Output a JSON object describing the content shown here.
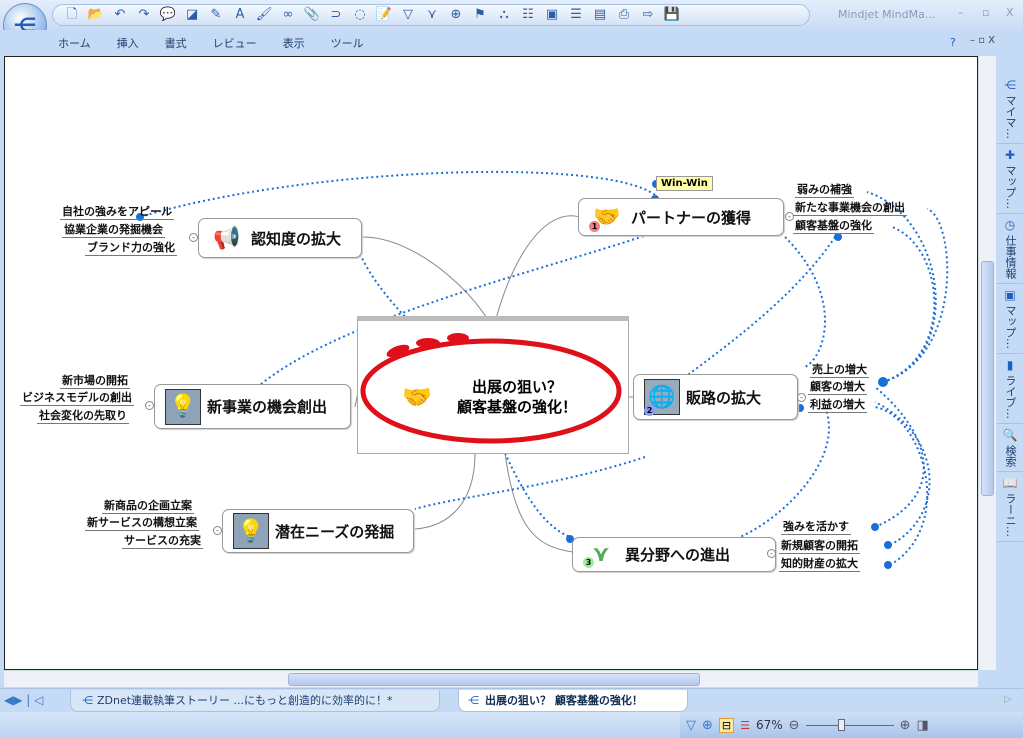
{
  "window": {
    "title": "Mindjet MindMa...",
    "app_button_icon": "mindmap-logo-icon"
  },
  "quick_access": [
    "new-icon",
    "open-icon",
    "undo-icon",
    "redo-icon",
    "callout-icon",
    "fill-color-icon",
    "line-color-icon",
    "font-color-icon",
    "format-painter-icon",
    "link-icon",
    "attach-icon",
    "relationship-icon",
    "boundary-icon",
    "notes-icon",
    "filter-icon",
    "funnel-icon",
    "add-icon",
    "marker-icon",
    "org-icon",
    "layout-icon",
    "slide-icon",
    "outline-icon",
    "gantt-icon",
    "print-icon",
    "export-icon",
    "save-icon"
  ],
  "ribbon_tabs": [
    "ホーム",
    "挿入",
    "書式",
    "レビュー",
    "表示",
    "ツール"
  ],
  "map": {
    "central": {
      "line1": "出展の狙い？",
      "line2": "顧客基盤の強化！"
    },
    "callout": "Win-Win",
    "topics": {
      "partner": {
        "label": "パートナーの獲得",
        "number": "1",
        "subs": [
          "弱みの補強",
          "新たな事業機会の創出",
          "顧客基盤の強化"
        ]
      },
      "sales": {
        "label": "販路の拡大",
        "number": "2",
        "subs": [
          "売上の増大",
          "顧客の増大",
          "利益の増大"
        ]
      },
      "newfield": {
        "label": "異分野への進出",
        "number": "3",
        "subs": [
          "強みを活かす",
          "新規顧客の開拓",
          "知的財産の拡大"
        ]
      },
      "awareness": {
        "label": "認知度の拡大",
        "subs": [
          "自社の強みをアピール",
          "協業企業の発掘機会",
          "ブランド力の強化"
        ]
      },
      "newbiz": {
        "label": "新事業の機会創出",
        "subs": [
          "新市場の開拓",
          "ビジネスモデルの創出",
          "社会変化の先取り"
        ]
      },
      "needs": {
        "label": "潜在ニーズの発掘",
        "subs": [
          "新商品の企画立案",
          "新サービスの構想立案",
          "サービスの充実"
        ]
      }
    }
  },
  "side_panel": [
    "マイマ…",
    "マップ…",
    "仕事情報",
    "マップ…",
    "ライブ…",
    "検索",
    "ラーニ…"
  ],
  "doc_tabs": [
    {
      "label": "ZDnet連載執筆ストーリー ...にもっと創造的に効率的に！*",
      "active": false
    },
    {
      "label": "出展の狙い？ 顧客基盤の強化！",
      "active": true
    }
  ],
  "status": {
    "zoom": "67%",
    "zoom_fraction": 0.4
  },
  "colors": {
    "accent": "#1f6fd0",
    "relationship": "#1a6fd6",
    "ellipse": "#e0101a"
  }
}
